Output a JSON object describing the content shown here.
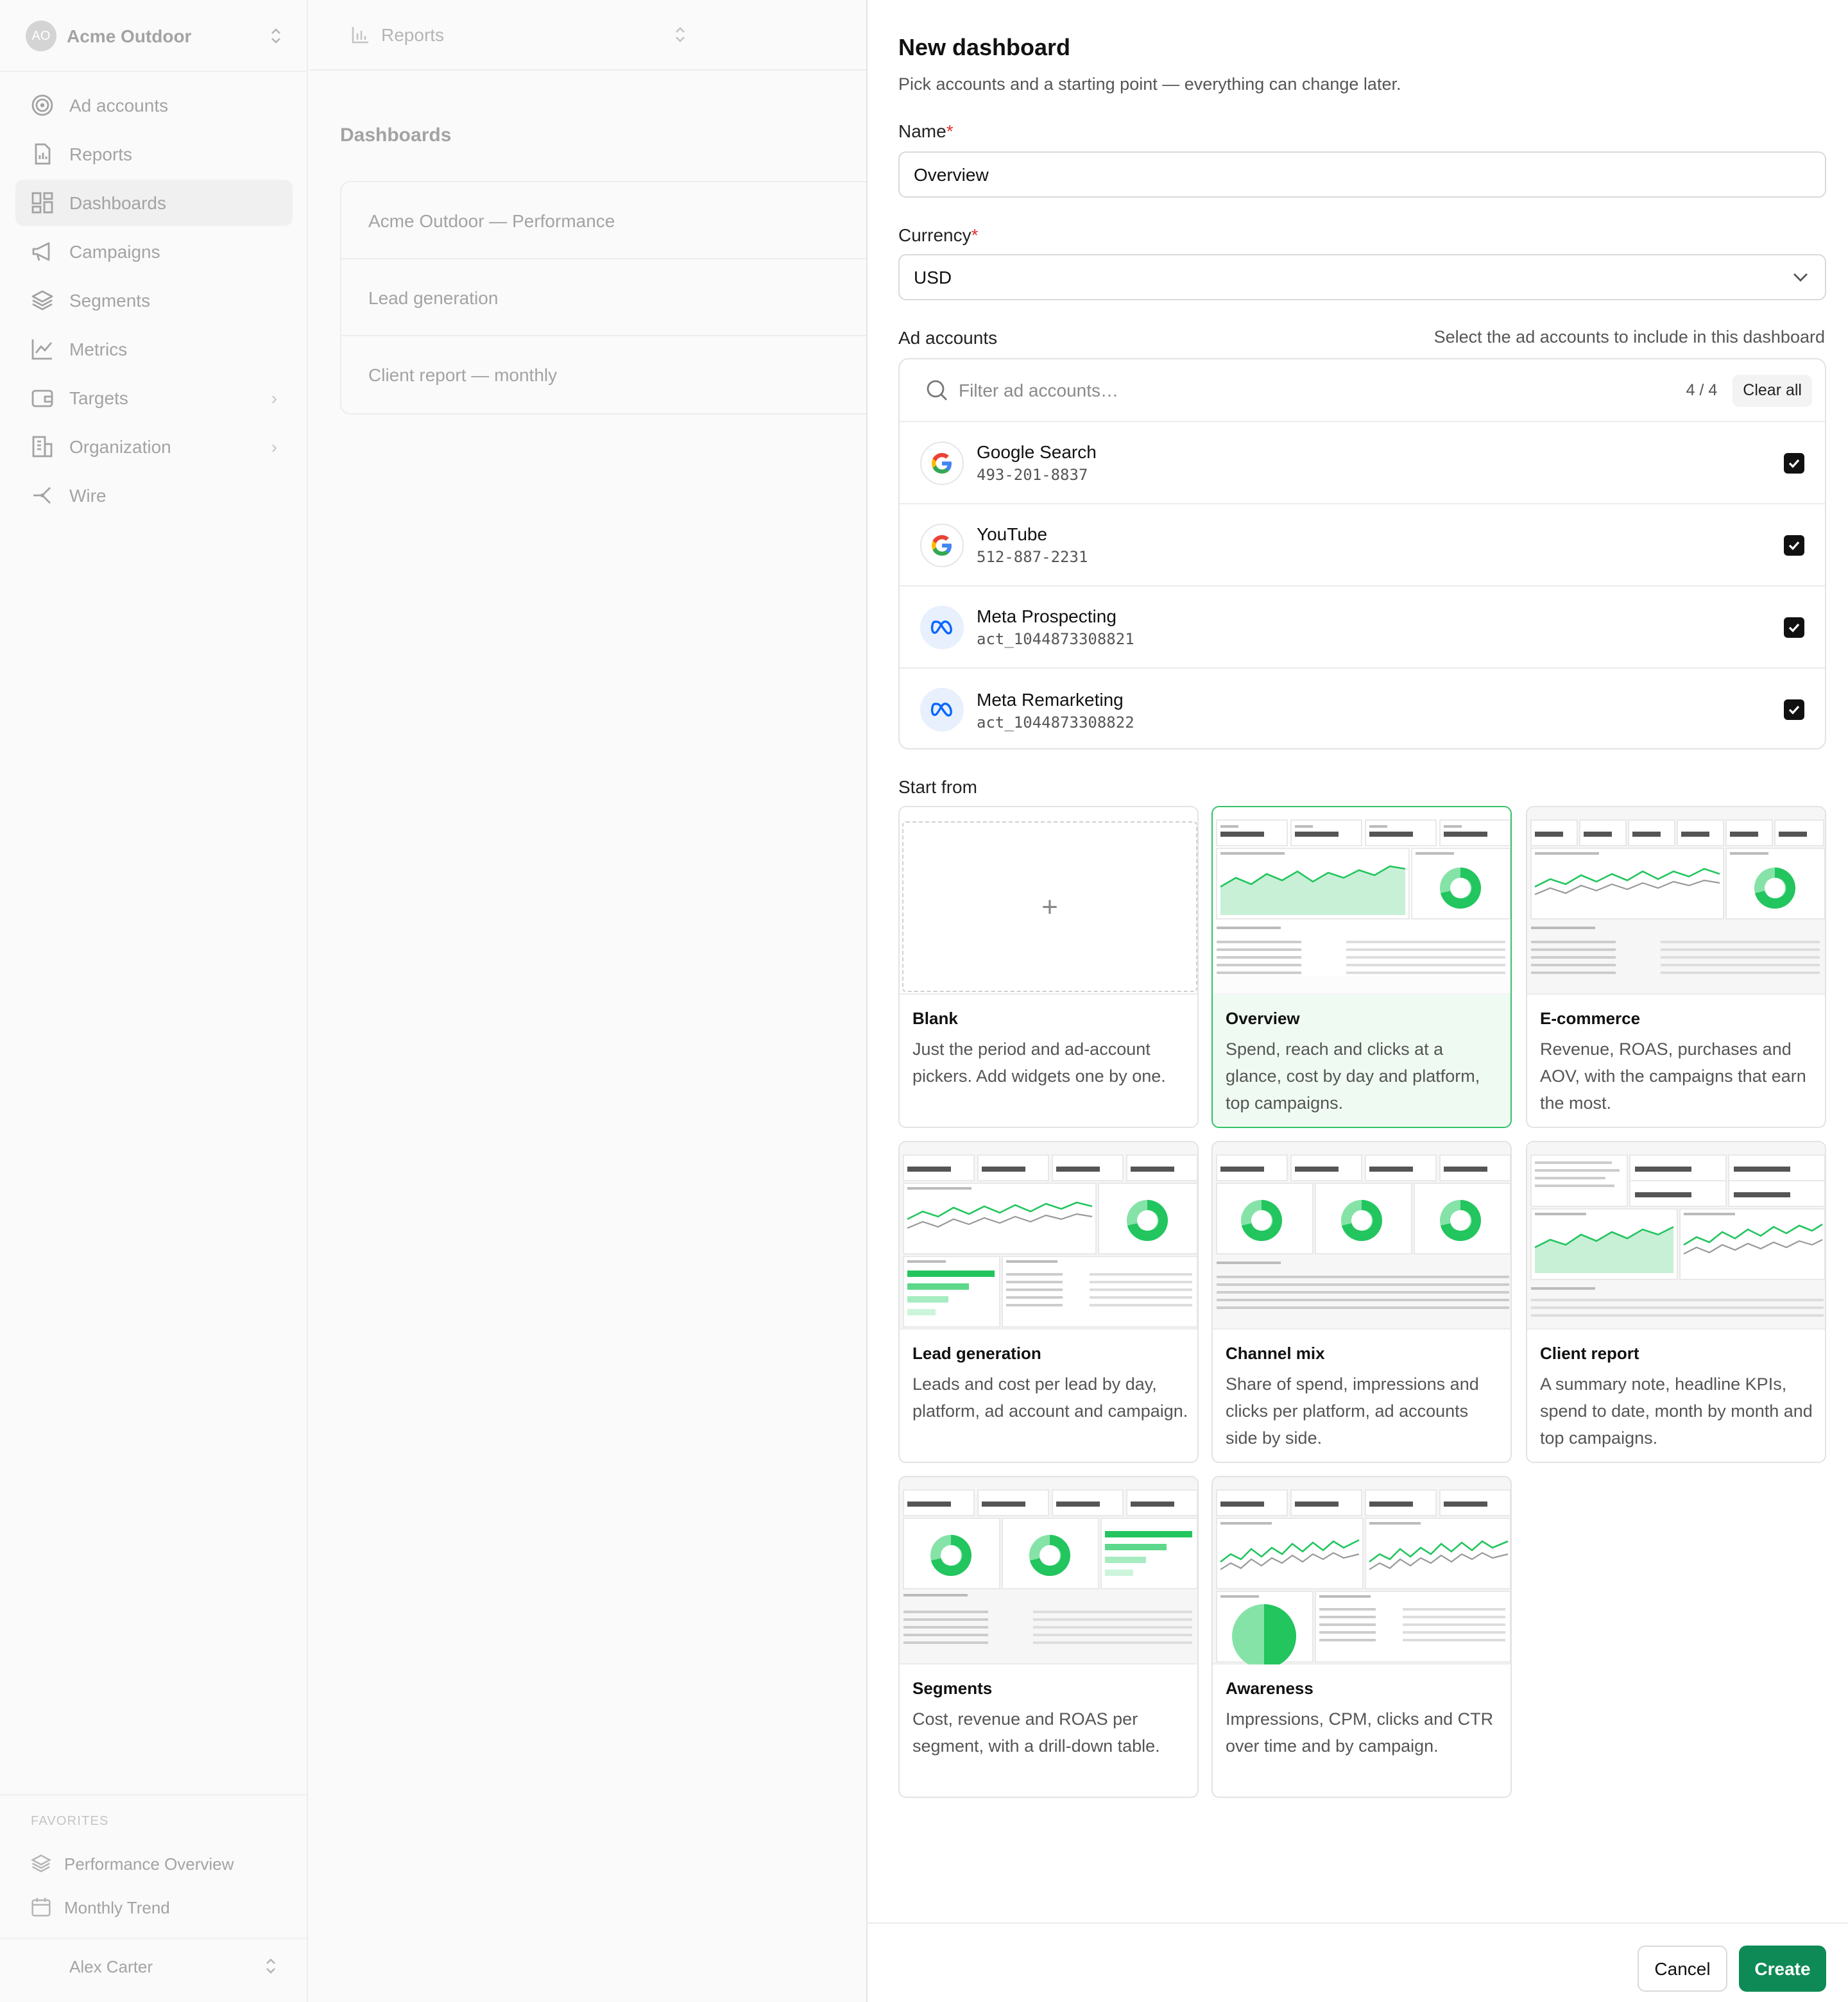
{
  "sidebar": {
    "org": {
      "initials": "AO",
      "name": "Acme Outdoor"
    },
    "items": [
      {
        "label": "Ad accounts",
        "icon": "target-icon"
      },
      {
        "label": "Reports",
        "icon": "report-icon"
      },
      {
        "label": "Dashboards",
        "icon": "dashboard-icon",
        "active": true
      },
      {
        "label": "Campaigns",
        "icon": "megaphone-icon"
      },
      {
        "label": "Segments",
        "icon": "layers-icon"
      },
      {
        "label": "Metrics",
        "icon": "line-chart-icon"
      },
      {
        "label": "Targets",
        "icon": "wallet-icon",
        "submenu": true
      },
      {
        "label": "Organization",
        "icon": "building-icon",
        "submenu": true
      },
      {
        "label": "Wire",
        "icon": "share-icon"
      }
    ],
    "favorites_label": "FAVORITES",
    "favorites": [
      {
        "label": "Performance Overview",
        "icon": "layers-icon"
      },
      {
        "label": "Monthly Trend",
        "icon": "calendar-icon"
      }
    ],
    "user": {
      "name": "Alex Carter"
    }
  },
  "main": {
    "topbar_label": "Reports",
    "title": "Dashboards",
    "dashboards": [
      "Acme Outdoor — Performance",
      "Lead generation",
      "Client report — monthly"
    ]
  },
  "dialog": {
    "title": "New dashboard",
    "subtitle": "Pick accounts and a starting point — everything can change later.",
    "name_label": "Name",
    "name_value": "Overview",
    "currency_label": "Currency",
    "currency_value": "USD",
    "required_mark": "*",
    "accounts_label": "Ad accounts",
    "accounts_hint": "Select the ad accounts to include in this dashboard",
    "filter_placeholder": "Filter ad accounts…",
    "selected_count": "4 / 4",
    "clear_all": "Clear all",
    "accounts": [
      {
        "name": "Google Search",
        "id": "493-201-8837",
        "platform": "google",
        "checked": true
      },
      {
        "name": "YouTube",
        "id": "512-887-2231",
        "platform": "google",
        "checked": true
      },
      {
        "name": "Meta Prospecting",
        "id": "act_1044873308821",
        "platform": "meta",
        "checked": true
      },
      {
        "name": "Meta Remarketing",
        "id": "act_1044873308822",
        "platform": "meta",
        "checked": true
      }
    ],
    "start_from_label": "Start from",
    "templates": [
      {
        "name": "Blank",
        "desc": "Just the period and ad-account pickers. Add widgets one by one.",
        "selected": false
      },
      {
        "name": "Overview",
        "desc": "Spend, reach and clicks at a glance, cost by day and platform, top campaigns.",
        "selected": true
      },
      {
        "name": "E-commerce",
        "desc": "Revenue, ROAS, purchases and AOV, with the campaigns that earn the most.",
        "selected": false
      },
      {
        "name": "Lead generation",
        "desc": "Leads and cost per lead by day, platform, ad account and campaign.",
        "selected": false
      },
      {
        "name": "Channel mix",
        "desc": "Share of spend, impressions and clicks per platform, ad accounts side by side.",
        "selected": false
      },
      {
        "name": "Client report",
        "desc": "A summary note, headline KPIs, spend to date, month by month and top campaigns.",
        "selected": false
      },
      {
        "name": "Segments",
        "desc": "Cost, revenue and ROAS per segment, with a drill-down table.",
        "selected": false
      },
      {
        "name": "Awareness",
        "desc": "Impressions, CPM, clicks and CTR over time and by campaign.",
        "selected": false
      }
    ],
    "cancel": "Cancel",
    "create": "Create"
  },
  "colors": {
    "accent": "#0e8a56",
    "chart_green": "#22c55e",
    "selected_border": "#34c268",
    "required": "#e03131"
  }
}
